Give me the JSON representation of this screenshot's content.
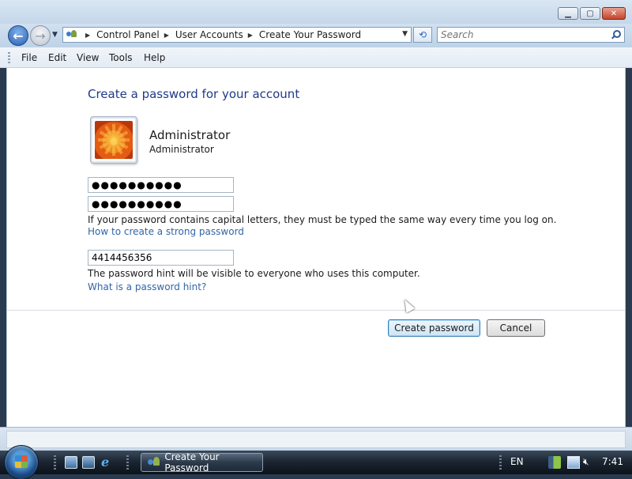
{
  "window": {
    "caption_buttons": [
      "minimize",
      "maximize",
      "close"
    ]
  },
  "navigation": {
    "breadcrumb": [
      "Control Panel",
      "User Accounts",
      "Create Your Password"
    ],
    "search_placeholder": "Search"
  },
  "menu": {
    "items": [
      "File",
      "Edit",
      "View",
      "Tools",
      "Help"
    ]
  },
  "content": {
    "heading": "Create a password for your account",
    "user": {
      "name": "Administrator",
      "role": "Administrator"
    },
    "password_mask": "●●●●●●●●●●",
    "confirm_mask": "●●●●●●●●●●",
    "caps_note": "If your password contains capital letters, they must be typed the same way every time you log on.",
    "strong_link": "How to create a strong password",
    "hint_value": "4414456356",
    "hint_note": "The password hint will be visible to everyone who uses this computer.",
    "hint_link": "What is a password hint?",
    "create_button": "Create password",
    "cancel_button": "Cancel"
  },
  "taskbar": {
    "task_label": "Create Your Password",
    "language": "EN",
    "clock": "7:41"
  },
  "icons": {
    "back": "back-arrow-icon",
    "forward": "forward-arrow-icon",
    "refresh": "refresh-icon",
    "search": "search-icon",
    "start": "windows-orb-icon",
    "ie": "internet-explorer-icon",
    "volume": "volume-muted-icon"
  },
  "colors": {
    "heading": "#1e3a8a",
    "link": "#3365a8",
    "primary_button_border": "#3c7fb1"
  }
}
